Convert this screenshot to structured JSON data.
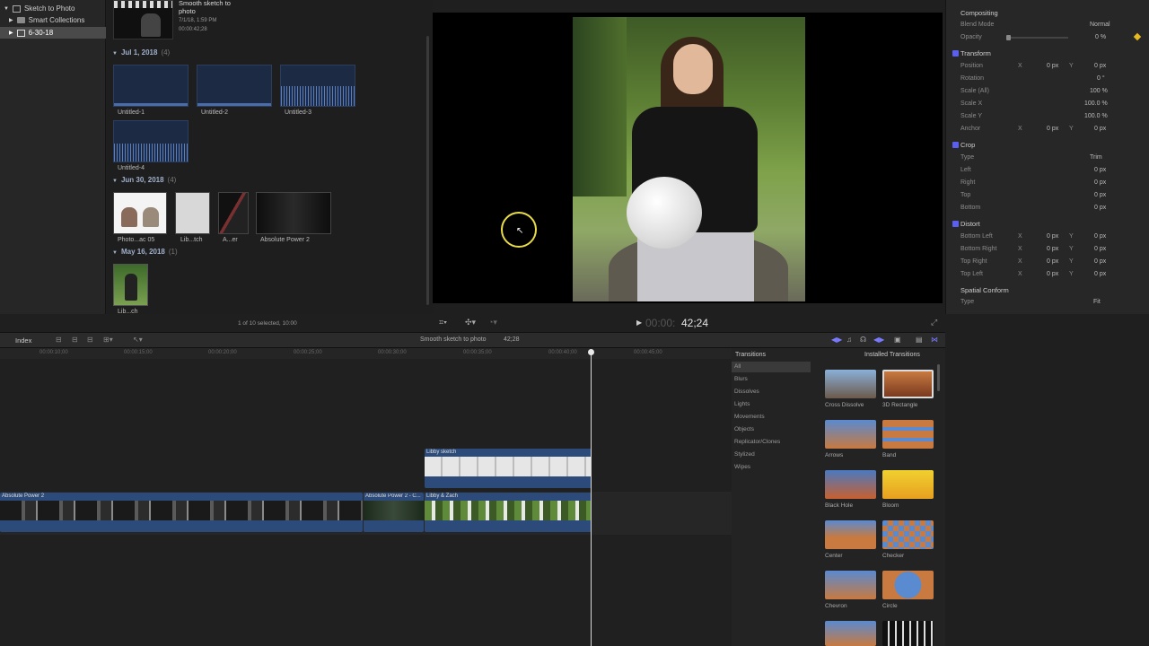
{
  "libraries": {
    "items": [
      {
        "label": "Sketch to Photo"
      },
      {
        "label": "Smart Collections"
      },
      {
        "label": "6-30-18"
      }
    ]
  },
  "browser": {
    "top_clip": {
      "title_line1": "Smooth sketch to",
      "title_line2": "photo",
      "date": "7/1/18, 1:59 PM",
      "duration": "00:00:42;28"
    },
    "groups": [
      {
        "label": "Jul 1, 2018",
        "count": "(4)"
      },
      {
        "label": "Jun 30, 2018",
        "count": "(4)"
      },
      {
        "label": "May 16, 2018",
        "count": "(1)"
      }
    ],
    "clips_jul": [
      "Untitled-1",
      "Untitled-2",
      "Untitled-3",
      "Untitled-4"
    ],
    "clips_jun": [
      "Photo...ac 05",
      "Lib...tch",
      "A...er",
      "Absolute Power 2"
    ],
    "clips_may": [
      "Lib...ch"
    ],
    "status": "1 of 10 selected, 10:00"
  },
  "viewer": {
    "timecode_dim": "00:00:",
    "timecode": "42;24"
  },
  "inspector": {
    "compositing": "Compositing",
    "blend_mode_label": "Blend Mode",
    "blend_mode_value": "Normal",
    "opacity_label": "Opacity",
    "opacity_value": "0 %",
    "transform": "Transform",
    "position": "Position",
    "rotation": "Rotation",
    "scale_all": "Scale (All)",
    "scale_x": "Scale X",
    "scale_y": "Scale Y",
    "anchor": "Anchor",
    "crop": "Crop",
    "type": "Type",
    "type_value": "Trim",
    "left": "Left",
    "right": "Right",
    "top": "Top",
    "bottom": "Bottom",
    "distort": "Distort",
    "bottom_left": "Bottom Left",
    "bottom_right": "Bottom Right",
    "top_right": "Top Right",
    "top_left": "Top Left",
    "spatial_conform": "Spatial Conform",
    "spatial_type_value": "Fit",
    "x": "X",
    "y": "Y",
    "zero_px": "0 px",
    "zero_deg": "0 °",
    "pct100": "100 %",
    "pct100_0": "100.0 %"
  },
  "timeline_toolbar": {
    "index": "Index",
    "project_name": "Smooth sketch to photo",
    "project_duration": "42;28"
  },
  "ruler_times": [
    "00:00:10;00",
    "00:00:15;00",
    "00:00:20;00",
    "00:00:25;00",
    "00:00:30;00",
    "00:00:35;00",
    "00:00:40;00",
    "00:00:45;00"
  ],
  "timeline": {
    "clip_sketch": "Libby sketch",
    "clip_absolute1": "Absolute Power 2",
    "clip_absolute2": "Absolute Power 2 - C...",
    "clip_libby": "Libby & Zach"
  },
  "transitions": {
    "header": "Transitions",
    "installed": "Installed Transitions",
    "categories": [
      "All",
      "Blurs",
      "Dissolves",
      "Lights",
      "Movements",
      "Objects",
      "Replicator/Clones",
      "Stylized",
      "Wipes"
    ],
    "items": [
      "Cross Dissolve",
      "3D Rectangle",
      "Arrows",
      "Band",
      "Black Hole",
      "Bloom",
      "Center",
      "Checker",
      "Chevron",
      "Circle"
    ]
  }
}
